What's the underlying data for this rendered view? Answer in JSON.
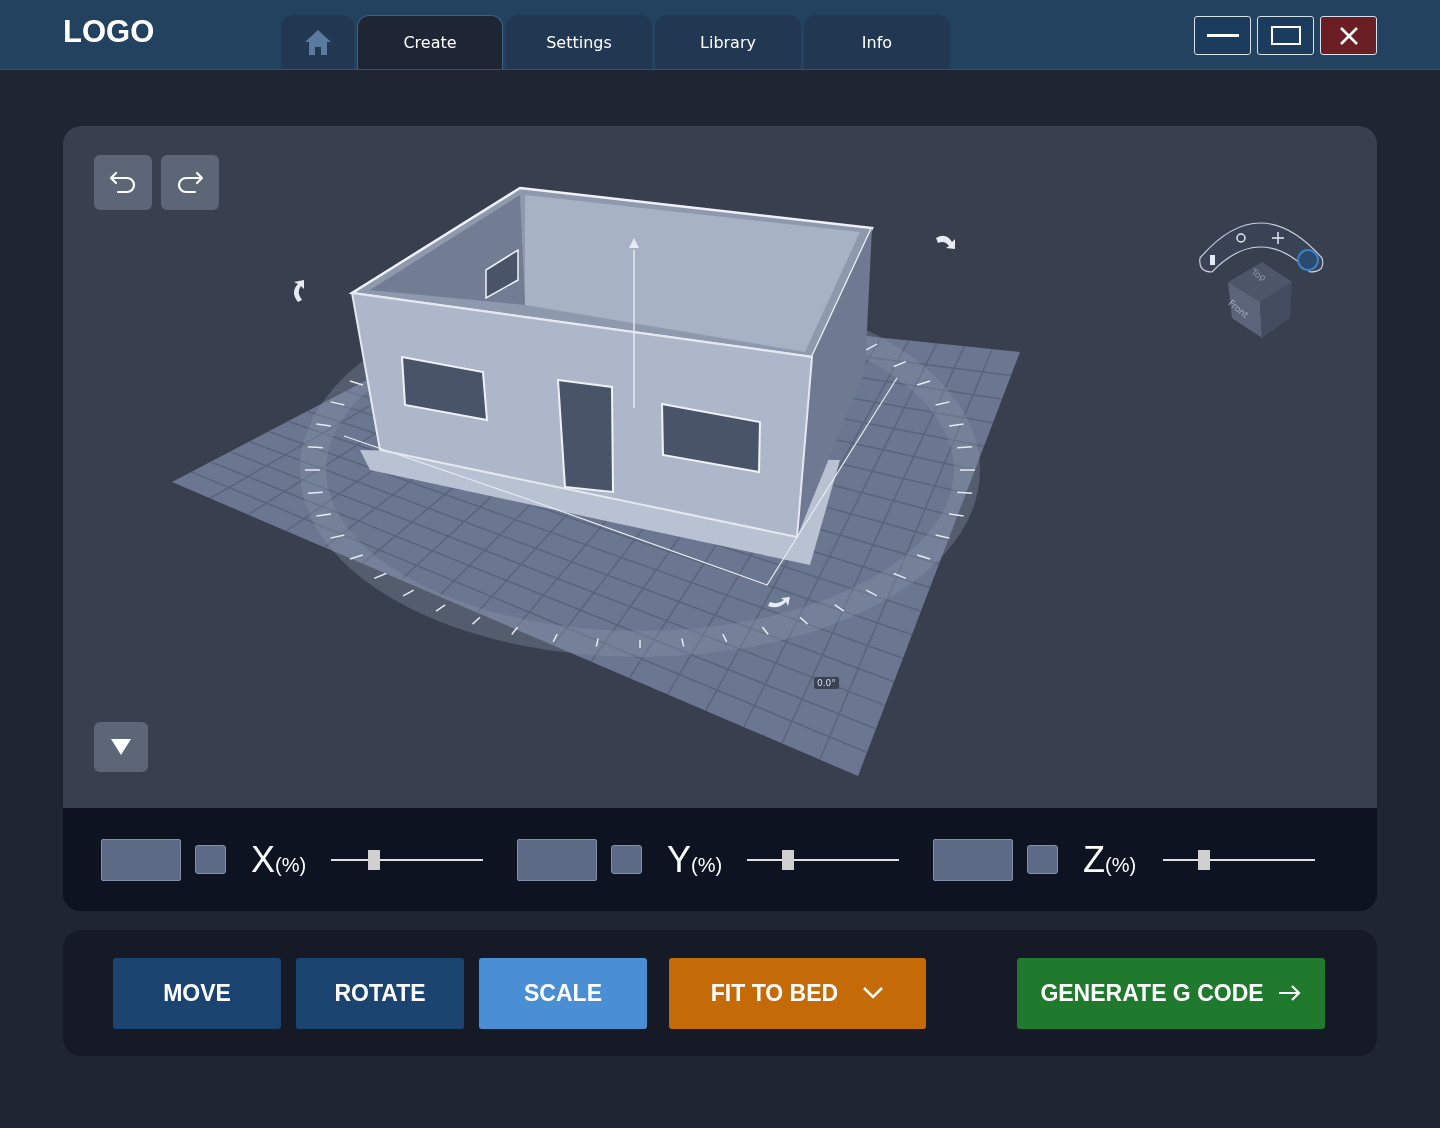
{
  "header": {
    "logo": "LOGO"
  },
  "tabs": [
    {
      "kind": "home",
      "selected": false
    },
    {
      "kind": "text",
      "label": "Create",
      "selected": true
    },
    {
      "kind": "text",
      "label": "Settings",
      "selected": false
    },
    {
      "kind": "text",
      "label": "Library",
      "selected": false
    },
    {
      "kind": "text",
      "label": "Info",
      "selected": false
    }
  ],
  "window_controls": [
    {
      "kind": "minimize"
    },
    {
      "kind": "maximize"
    },
    {
      "kind": "close"
    }
  ],
  "viewport": {
    "angle_label": "0.0°",
    "view_cube": {
      "top": "Top",
      "front": "Front"
    }
  },
  "axes": [
    {
      "axis": "X",
      "unit": "(%)",
      "checked": false,
      "level": 0.28
    },
    {
      "axis": "Y",
      "unit": "(%)",
      "checked": false,
      "level": 0.27
    },
    {
      "axis": "Z",
      "unit": "(%)",
      "checked": false,
      "level": 0.27
    }
  ],
  "actions": [
    {
      "label": "MOVE",
      "kind": "mode",
      "selected": false
    },
    {
      "label": "ROTATE",
      "kind": "mode",
      "selected": false
    },
    {
      "label": "SCALE",
      "kind": "mode",
      "selected": true
    },
    {
      "label": "FIT TO BED",
      "kind": "dropdown"
    },
    {
      "label": "GENERATE G CODE",
      "kind": "primary"
    }
  ]
}
